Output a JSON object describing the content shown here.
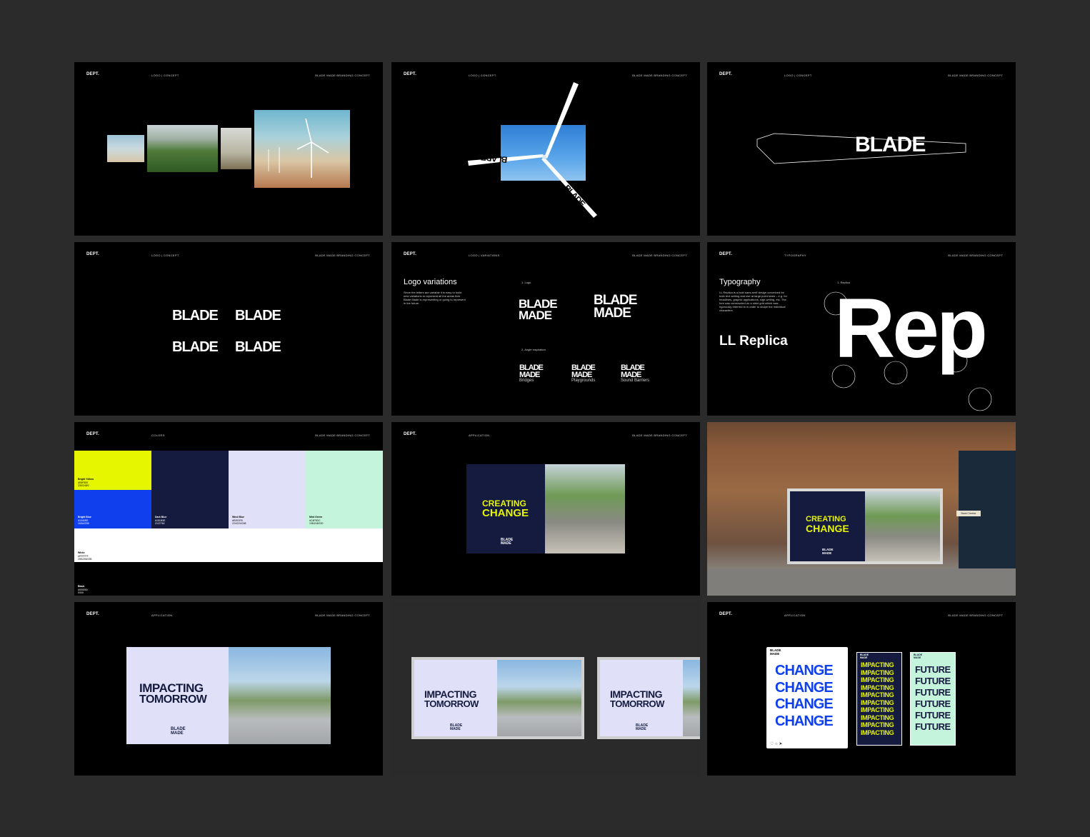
{
  "common": {
    "brand": "DEPT.",
    "project": "BLADE MADE BRANDING CONCEPT"
  },
  "slides": [
    {
      "section": "LOGO | CONCEPT"
    },
    {
      "section": "LOGO | CONCEPT",
      "blade_words": [
        "BLADE",
        "BLADE",
        "BLADE"
      ]
    },
    {
      "section": "LOGO | CONCEPT",
      "wordmark": "BLADE"
    },
    {
      "section": "LOGO | CONCEPT",
      "variants": [
        "BLADE",
        "BLADE",
        "BLADE",
        "BLADE"
      ]
    },
    {
      "section": "LOGO | VARIATIONS",
      "title": "Logo variations",
      "body": "Since the letters are variable it is easy to build new variations to represent all the areas that Blade Made is representing or going to represent in the future.",
      "label1": "1. Logo",
      "label2": "2. Angle inspiration",
      "logo_line1": "BLADE",
      "logo_line2": "MADE",
      "angles": [
        "Bridges",
        "Playgrounds",
        "Sound Barriers"
      ]
    },
    {
      "section": "TYPOGRAPHY",
      "title": "Typography",
      "body": "LL Replica is a bold sans-serif design conceived for both text setting and use at large point sizes – e.g. for headlines, graphic applications, sign-writing, etc. The font was constructed on a strict grid which was rigorously referred to in order to shape the individual characters.",
      "label": "1. Replica",
      "font_name": "LL Replica",
      "sample": "Rep"
    },
    {
      "section": "COLORS",
      "swatches": [
        {
          "name": "Bright Yellow",
          "color": "#e6f500",
          "lines": [
            "#E6F500",
            "230/245/0"
          ]
        },
        {
          "name": "Bright Blue",
          "color": "#1040ee",
          "lines": [
            "#1040EE",
            "16/64/238"
          ]
        },
        {
          "name": "Dark Blue",
          "color": "#151b3e",
          "lines": [
            "#151B3E",
            "21/27/62"
          ]
        },
        {
          "name": "Wind Blue",
          "color": "#e0e0f8",
          "lines": [
            "#E0E0F8",
            "224/224/248"
          ]
        },
        {
          "name": "Mint Green",
          "color": "#c4f5dc",
          "lines": [
            "#C4F5DC",
            "196/245/220"
          ]
        },
        {
          "name": "White",
          "color": "#ffffff",
          "lines": [
            "#FFFFFF",
            "255/255/255"
          ]
        },
        {
          "name": "Black",
          "color": "#000000",
          "lines": [
            "#000000",
            "0/0/0"
          ]
        }
      ]
    },
    {
      "section": "APPLICATION",
      "headline1": "CREATING",
      "headline2": "CHANGE",
      "mark1": "BLADE",
      "mark2": "MADE"
    },
    {
      "headline1": "CREATING",
      "headline2": "CHANGE",
      "mark1": "BLADE",
      "mark2": "MADE",
      "sign": "Bank Cheese"
    },
    {
      "section": "APPLICATION",
      "headline1": "IMPACTING",
      "headline2": "TOMORROW",
      "mark1": "BLADE",
      "mark2": "MADE"
    },
    {
      "headline1": "IMPACTING",
      "headline2": "TOMORROW",
      "mark1": "BLADE",
      "mark2": "MADE"
    },
    {
      "section": "APPLICATION",
      "post_word": "CHANGE",
      "story1_word": "IMPACTING",
      "story2_word": "FUTURE",
      "mark1": "BLADE",
      "mark2": "MADE"
    }
  ]
}
